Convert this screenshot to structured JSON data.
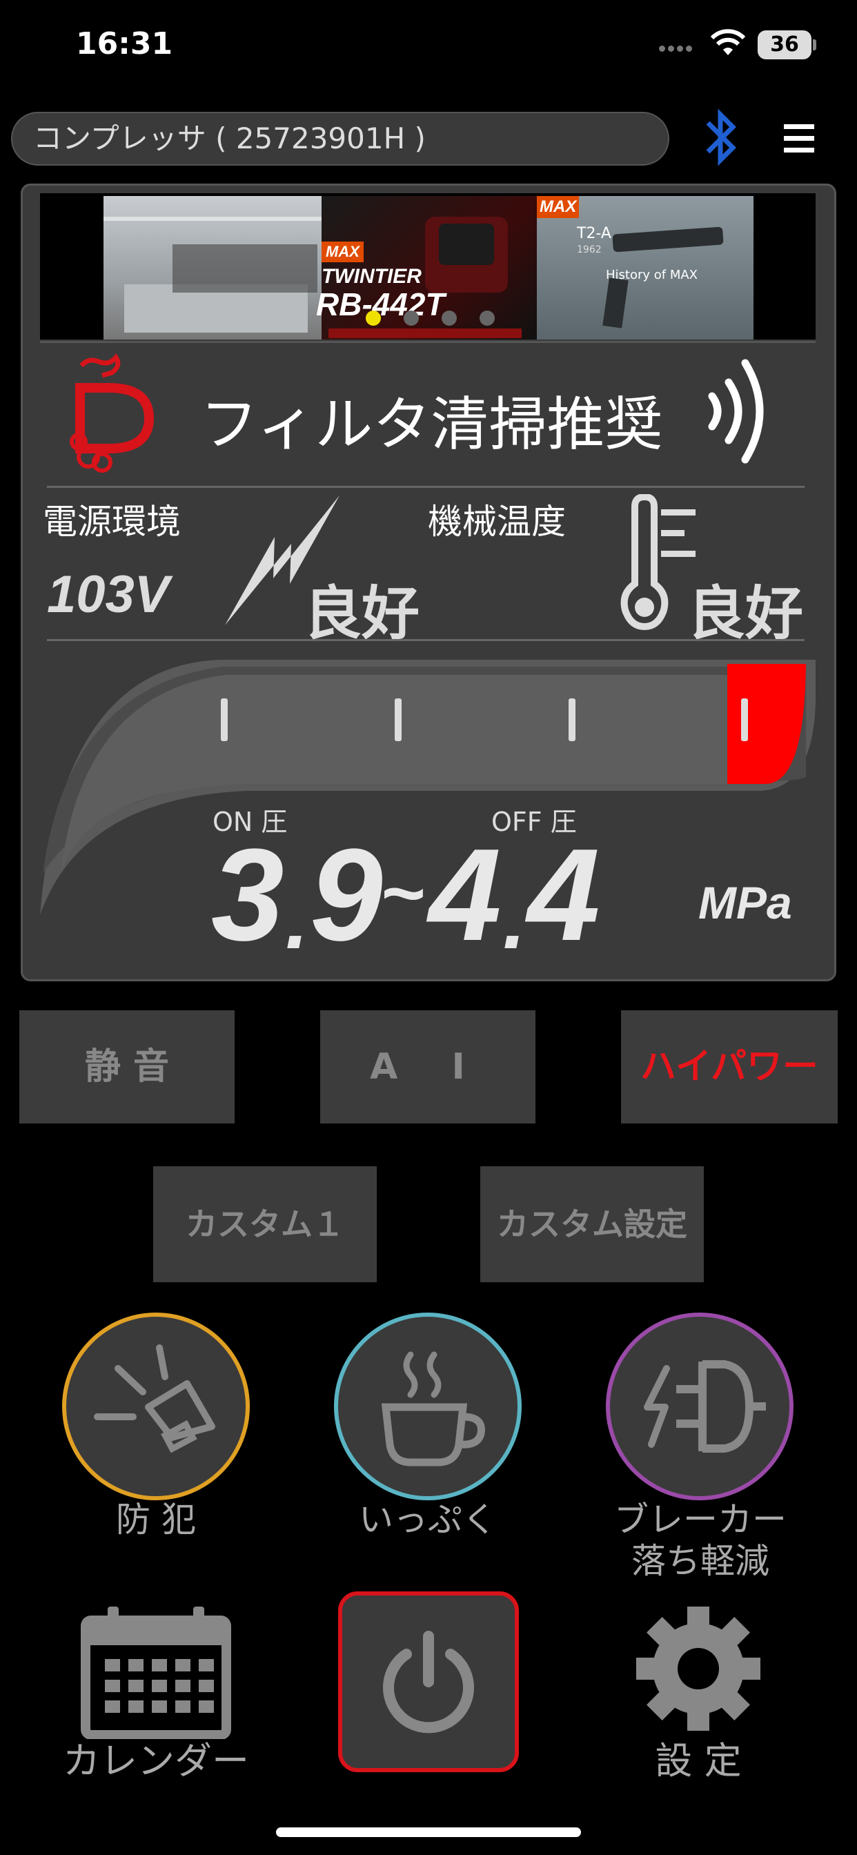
{
  "status_bar": {
    "time": "16:31",
    "battery": "36"
  },
  "header": {
    "device_title": "コンプレッサ ( 25723901H )"
  },
  "banner": {
    "slide2_brand": "MAX",
    "slide2_product": "TWINTIER",
    "slide2_model": "RB-442T",
    "slide3_brand": "MAX",
    "slide3_model": "T2-A",
    "slide3_year": "1962",
    "slide3_caption": "History of MAX",
    "page_dots": 4,
    "active_dot": 0
  },
  "status": {
    "message": "フィルタ清掃推奨"
  },
  "power_env": {
    "label": "電源環境",
    "voltage": "103V",
    "state": "良好"
  },
  "machine_temp": {
    "label": "機械温度",
    "state": "良好"
  },
  "gauge": {
    "on_label": "ON 圧",
    "off_label": "OFF 圧",
    "on_int": "3",
    "on_dec": "9",
    "separator": "~",
    "off_int": "4",
    "off_dec": "4",
    "unit": "MPa",
    "fill_fraction": 0.12
  },
  "modes": {
    "quiet": "静 音",
    "ai": "A I",
    "high_power": "ハイパワー",
    "custom1": "カスタム１",
    "custom_settings": "カスタム設定",
    "active": "high_power"
  },
  "functions": {
    "security": "防 犯",
    "break": "いっぷく",
    "breaker_line1": "ブレーカー",
    "breaker_line2": "落ち軽減"
  },
  "bottom": {
    "calendar": "カレンダー",
    "settings": "設 定"
  },
  "colors": {
    "accent_red": "#d8131a",
    "security_ring": "#e0a024",
    "break_ring": "#5ab4c4",
    "breaker_ring": "#9a4aa8",
    "bluetooth": "#1f5fd1"
  },
  "icons": [
    "bluetooth-icon",
    "hamburger-menu-icon",
    "alert-d-icon",
    "signal-waves-icon",
    "lightning-icon",
    "thermometer-icon",
    "alarm-speaker-icon",
    "coffee-cup-icon",
    "plug-bolt-icon",
    "calendar-icon",
    "power-icon",
    "gear-icon"
  ]
}
